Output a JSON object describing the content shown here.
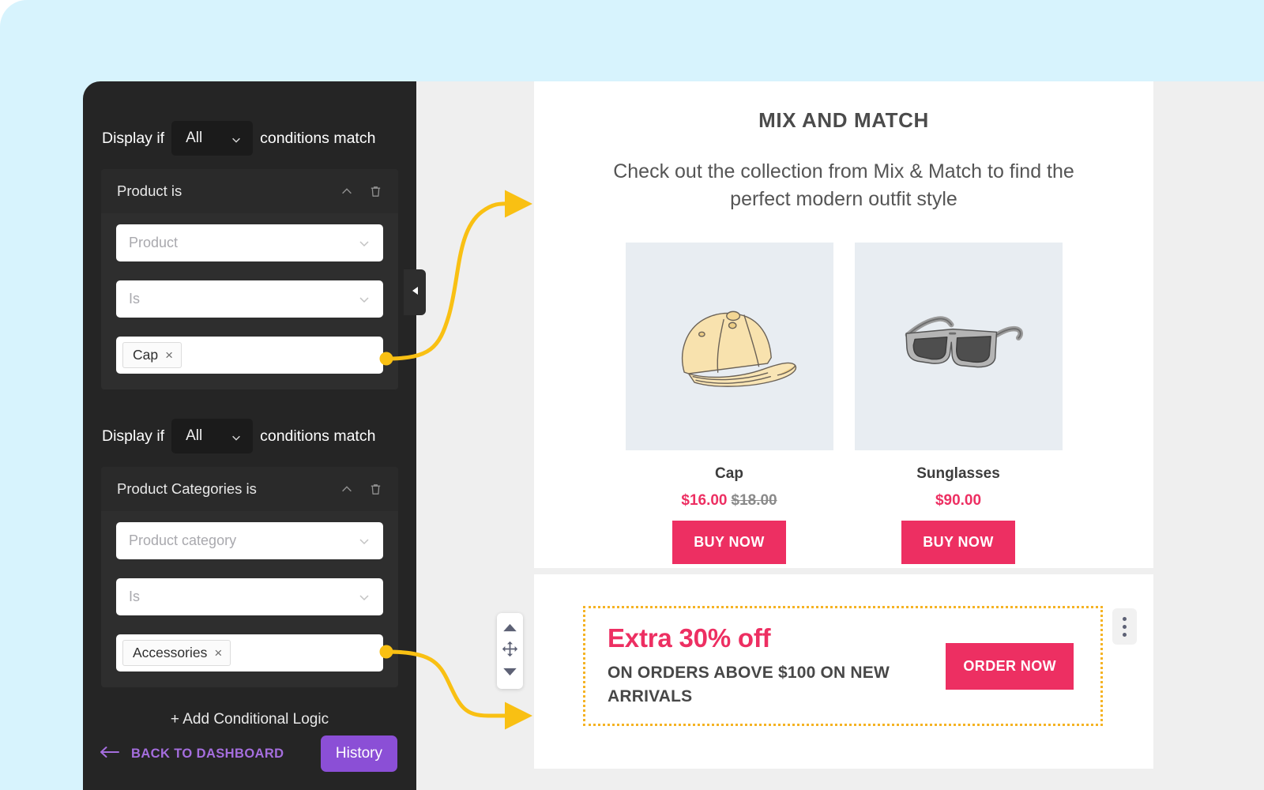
{
  "theme": {
    "mat_bg": "#d7f3fd",
    "panel_dark": "#252525",
    "accent_pink": "#ed2f62",
    "accent_purple": "#8b4fd6",
    "connector_yellow": "#f9c013",
    "promo_border": "#f5b324"
  },
  "settings": {
    "conditions": [
      {
        "prefix_label": "Display if",
        "match_value": "All",
        "suffix_label": "conditions match",
        "card_title": "Product is",
        "collapse_icon": "chevron-up-icon",
        "delete_icon": "trash-icon",
        "field_one_placeholder": "Product",
        "field_two_placeholder": "Is",
        "token_label": "Cap",
        "token_remove": "×"
      },
      {
        "prefix_label": "Display if",
        "match_value": "All",
        "suffix_label": "conditions match",
        "card_title": "Product Categories is",
        "collapse_icon": "chevron-up-icon",
        "delete_icon": "trash-icon",
        "field_one_placeholder": "Product category",
        "field_two_placeholder": "Is",
        "token_label": "Accessories",
        "token_remove": "×"
      }
    ],
    "add_logic_label": "+ Add Conditional Logic",
    "back_to_dashboard_label": "BACK TO DASHBOARD",
    "back_arrow_icon": "arrow-left-icon",
    "history_label": "History"
  },
  "collapse_tab": {
    "icon": "triangle-left-icon"
  },
  "move_toolbar": {
    "up_icon": "triangle-up-icon",
    "move_icon": "move-cross-icon",
    "down_icon": "triangle-down-icon"
  },
  "email": {
    "hero": {
      "title": "MIX AND MATCH",
      "subtitle": "Check out the collection from Mix & Match to find the perfect modern outfit style",
      "products": [
        {
          "image": "cap-illustration",
          "name": "Cap",
          "price": "$16.00",
          "price_old": "$18.00",
          "cta": "BUY NOW"
        },
        {
          "image": "sunglasses-illustration",
          "name": "Sunglasses",
          "price": "$90.00",
          "price_old": "",
          "cta": "BUY NOW"
        }
      ]
    },
    "promo": {
      "headline": "Extra 30% off",
      "subline": "ON ORDERS ABOVE $100 ON NEW ARRIVALS",
      "cta": "ORDER NOW",
      "menu_icon": "kebab-menu-icon"
    }
  }
}
